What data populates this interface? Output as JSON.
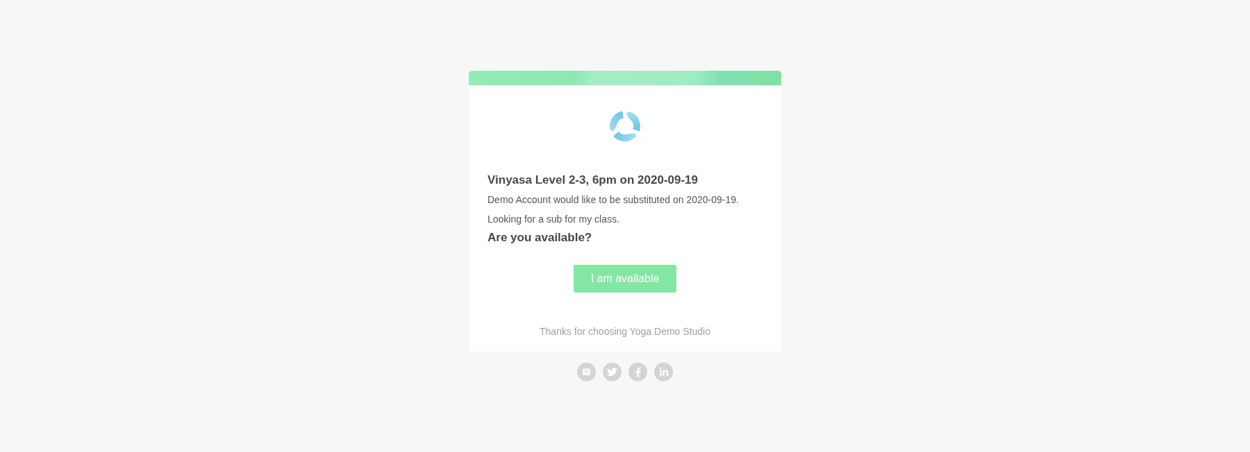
{
  "card": {
    "title": "Vinyasa Level 2-3, 6pm on 2020-09-19",
    "lines": [
      "Demo Account would like to be substituted on 2020-09-19.",
      "Looking for a sub for my class."
    ],
    "question": "Are you available?",
    "button": "I am available",
    "footer": "Thanks for choosing Yoga Demo Studio"
  }
}
